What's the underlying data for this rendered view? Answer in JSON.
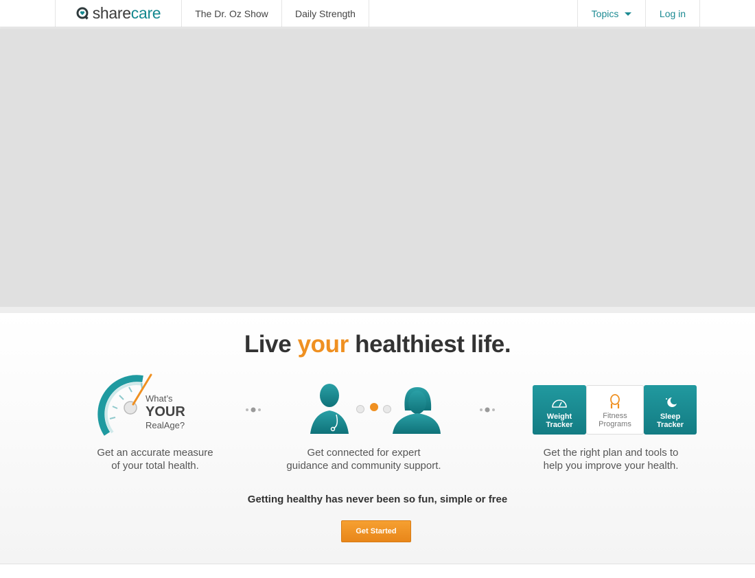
{
  "nav": {
    "logo_share": "share",
    "logo_care": "care",
    "dr_oz": "The Dr. Oz Show",
    "daily_strength": "Daily Strength",
    "topics": "Topics",
    "login": "Log in"
  },
  "main": {
    "headline_pre": "Live ",
    "headline_highlight": "your",
    "headline_post": " healthiest life.",
    "realage": {
      "what": "What’s",
      "your": "YOUR",
      "realage": "RealAge?",
      "caption_line1": "Get an accurate measure",
      "caption_line2": "of your total health."
    },
    "connect": {
      "caption_line1": "Get connected for expert",
      "caption_line2": "guidance and community support."
    },
    "plan": {
      "weight_line1": "Weight",
      "weight_line2": "Tracker",
      "fitness_line1": "Fitness",
      "fitness_line2": "Programs",
      "sleep_line1": "Sleep",
      "sleep_line2": "Tracker",
      "caption_line1": "Get the right plan and tools to",
      "caption_line2": "help you improve your health."
    },
    "subheadline": "Getting healthy has never been so fun, simple or free",
    "cta": "Get Started"
  },
  "colors": {
    "brand_teal": "#14888f",
    "accent_orange": "#ef9021"
  }
}
